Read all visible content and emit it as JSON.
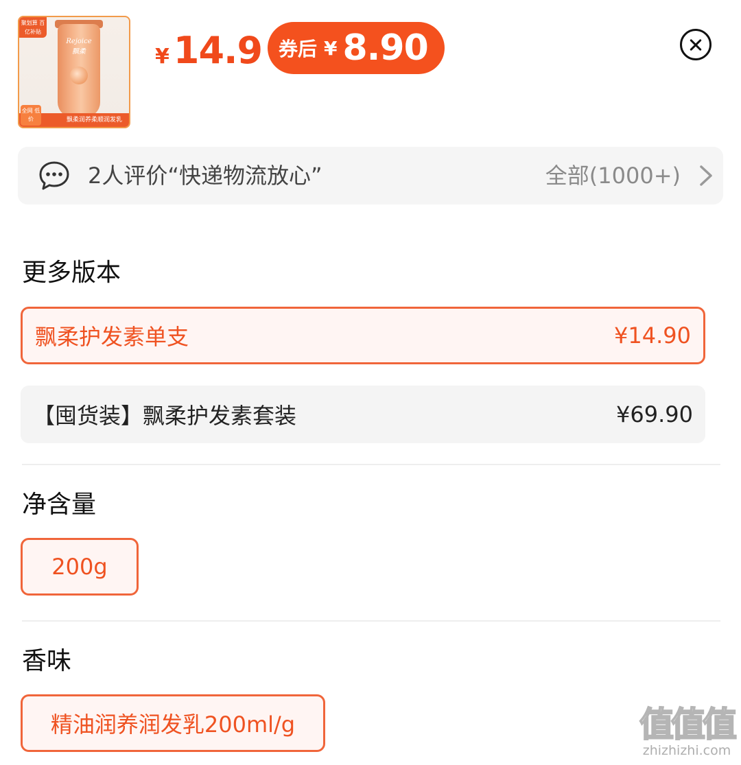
{
  "product": {
    "thumbnail": {
      "corner_tag": "聚划算 百亿补贴",
      "brand_text": "Rejoice 飘柔",
      "bottom_band": "飘柔润养柔顺润发乳",
      "low_price_tag": "全网 低价"
    },
    "price_currency": "¥",
    "price_now": "14.9",
    "coupon_label": "券后",
    "coupon_currency": "¥",
    "coupon_price": "8.90"
  },
  "close_icon": "close-circle-icon",
  "review": {
    "icon": "chat-bubble-icon",
    "text": "2人评价“快递物流放心”",
    "all_text": "全部(1000+)",
    "chevron_icon": "chevron-right-icon"
  },
  "sections": {
    "versions": {
      "title": "更多版本",
      "items": [
        {
          "label": "飘柔护发素单支",
          "price": "¥14.90",
          "selected": true
        },
        {
          "label": "【囤货装】飘柔护发素套装",
          "price": "¥69.90",
          "selected": false
        }
      ]
    },
    "net_content": {
      "title": "净含量",
      "options": [
        "200g"
      ]
    },
    "scent": {
      "title": "香味",
      "options": [
        "精油润养润发乳200ml/g"
      ]
    }
  },
  "watermark": {
    "glyphs": "值值值",
    "url": "zhizhizhi.com"
  },
  "colors": {
    "accent": "#f0491b",
    "coupon_bg": "#f4511e",
    "selected_border": "#f0653a",
    "selected_bg": "#fff5f3",
    "panel_bg": "#f5f5f5"
  }
}
